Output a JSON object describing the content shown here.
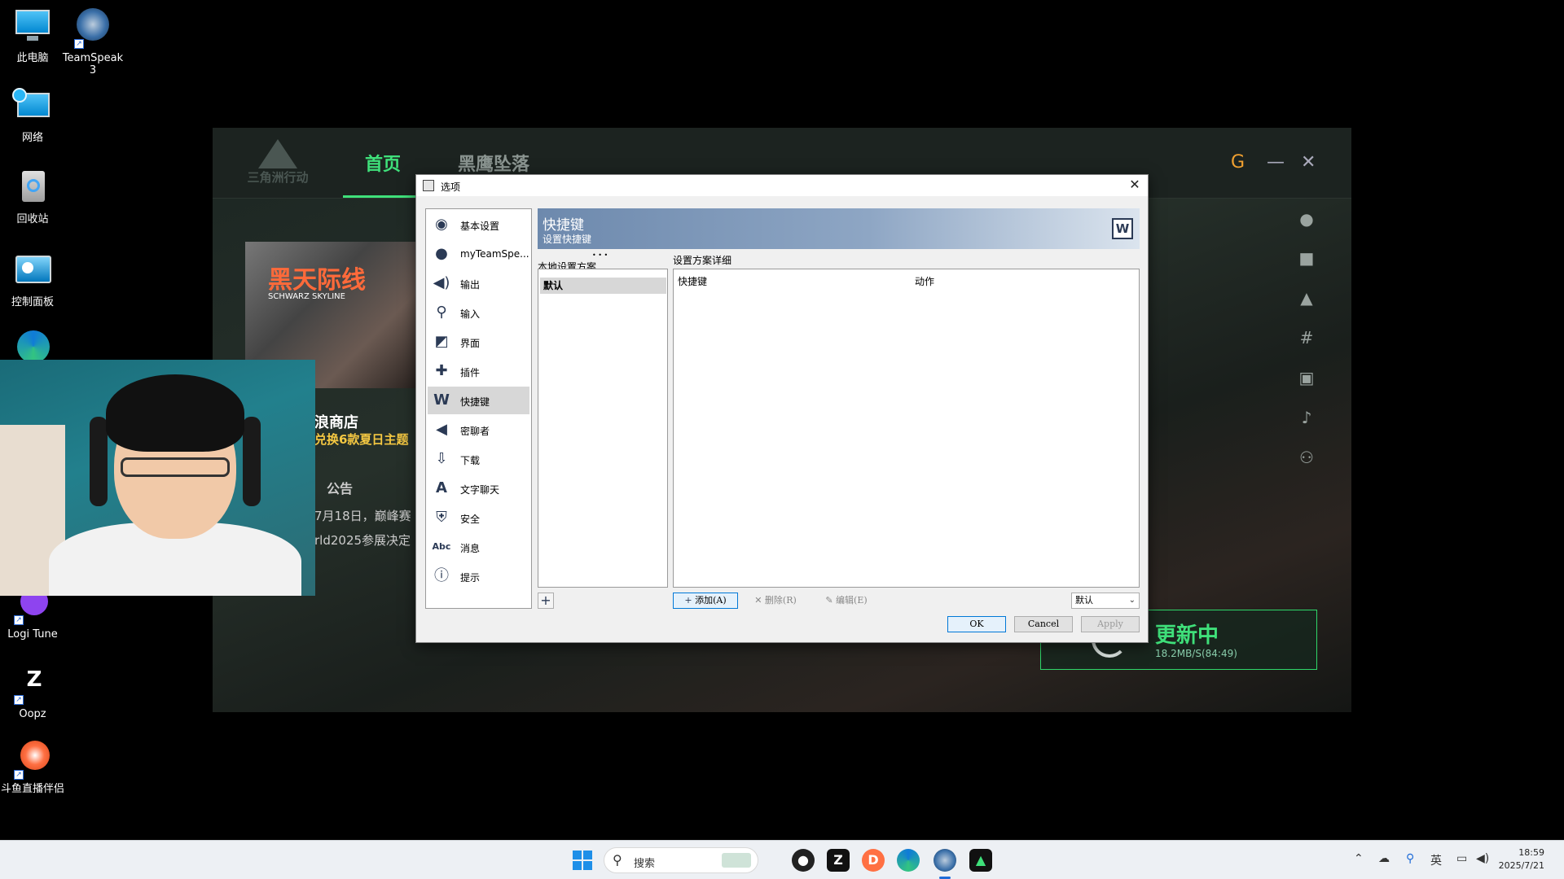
{
  "desktop": {
    "icons": [
      {
        "label": "此电脑"
      },
      {
        "label": "TeamSpeak 3"
      },
      {
        "label": "网络"
      },
      {
        "label": "回收站"
      },
      {
        "label": "控制面板"
      },
      {
        "label": "Logi Tune"
      },
      {
        "label": "Oopz"
      },
      {
        "label": "斗鱼直播伴侣"
      }
    ]
  },
  "launcher": {
    "logo_text": "三角洲行动",
    "tabs": [
      {
        "label": "首页"
      },
      {
        "label": "黑鹰坠落"
      }
    ],
    "promo_title": "黑天际线",
    "promo_subtitle": "SCHWARZ SKYLINE",
    "store_title": "浪商店",
    "store_sub": "兑换6款夏日主题",
    "announce_tab": "公告",
    "news_1": "7月18日，巅峰赛",
    "news_2": "rld2025参展决定",
    "update_title": "更新中",
    "update_speed": "18.2MB/S(84:49)"
  },
  "dialog": {
    "title": "选项",
    "close": "✕",
    "nav": [
      {
        "label": "基本设置",
        "icon": "ts-icon"
      },
      {
        "label": "myTeamSpe...",
        "icon": "user-icon"
      },
      {
        "label": "输出",
        "icon": "speaker-icon"
      },
      {
        "label": "输入",
        "icon": "microphone-icon"
      },
      {
        "label": "界面",
        "icon": "interface-icon"
      },
      {
        "label": "插件",
        "icon": "plugin-icon"
      },
      {
        "label": "快捷键",
        "icon": "hotkey-icon"
      },
      {
        "label": "密聊者",
        "icon": "whisper-icon"
      },
      {
        "label": "下载",
        "icon": "download-icon"
      },
      {
        "label": "文字聊天",
        "icon": "chat-icon"
      },
      {
        "label": "安全",
        "icon": "shield-icon"
      },
      {
        "label": "消息",
        "icon": "message-icon"
      },
      {
        "label": "提示",
        "icon": "info-icon"
      }
    ],
    "header_title": "快捷键",
    "header_subtitle": "设置快捷键",
    "profiles_label": "本地设置方案",
    "profiles_dots": "• • •",
    "profiles": [
      {
        "label": "默认"
      }
    ],
    "details_label": "设置方案详细",
    "columns": {
      "hotkey": "快捷键",
      "action": "动作"
    },
    "add_button": "添加(A)",
    "delete_button": "删除(R)",
    "edit_button": "编辑(E)",
    "dropdown_value": "默认",
    "ok": "OK",
    "cancel": "Cancel",
    "apply": "Apply"
  },
  "taskbar": {
    "search_placeholder": "搜索",
    "tray_lang": "英",
    "time": "18:59",
    "date": "2025/7/21"
  }
}
